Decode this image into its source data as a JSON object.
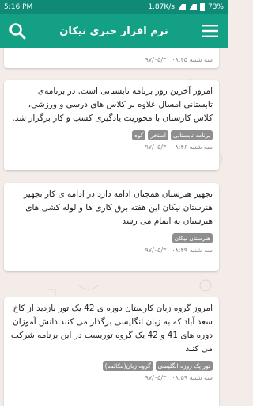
{
  "status_bar": {
    "time": "5:16 PM",
    "speed": "1.87K/s",
    "battery": "73%"
  },
  "app_bar": {
    "title": "نرم افزار خبری نیکان"
  },
  "colors": {
    "status": "#0f8a77",
    "primary": "#14a085",
    "tag": "#8e8e8e"
  },
  "icons": {
    "menu": "menu-icon",
    "search": "search-icon"
  },
  "posts": [
    {
      "text": "",
      "tags": [],
      "date": "سه شنبه ۰۸:۴۵ ۹۷/۰۵/۳۰"
    },
    {
      "text": "امروز آخرین روز برنامه تابستانی است. در برنامه‌ی تابستانی امسال علاوه بر کلاس های درسی و ورزشی، کلاس کارستان با محوریت یادگیری کسب و کار برگزار شد.",
      "tags": [
        "برنامه تابستانی",
        "استخر",
        "کوه"
      ],
      "date": "سه شنبه ۰۸:۴۶ ۹۷/۰۵/۳۰"
    },
    {
      "text": "تجهیز هنرستان همچنان ادامه دارد در ادامه ی کار تجهیز هنرستان نیکان این هفته برق کاری ها و لوله کشی های هنرستان به اتمام می رسد",
      "tags": [
        "هنرستان نیکان"
      ],
      "date": "سه شنبه ۰۸:۴۹ ۹۷/۰۵/۳۰"
    },
    {
      "text": "امروز گروه زبان کارستان دوره ی 42 یک تور بازدید از کاخ سعد آباد که به زبان انگلیسی برگذار می کنند دانش آموزان دوره های 41 و 42 یک گروه توریست در این برنامه شرکت می کنند",
      "tags": [
        "تور یک روزه انگلیسی",
        "گروه زبان(مکالمه)"
      ],
      "date": "سه شنبه ۰۸:۵۹ ۹۷/۰۵/۳۰"
    }
  ]
}
